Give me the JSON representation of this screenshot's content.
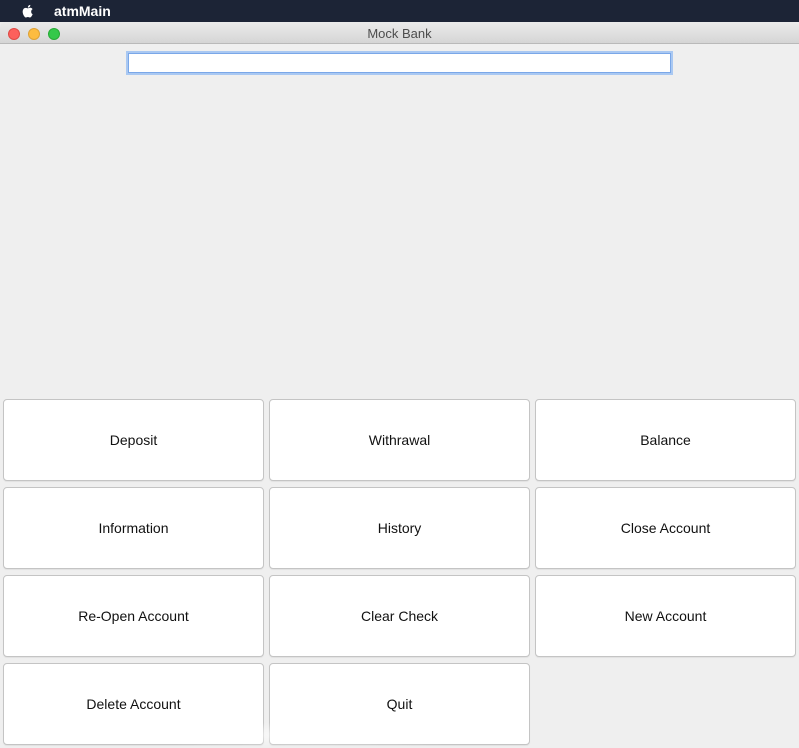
{
  "menubar": {
    "app_name": "atmMain"
  },
  "window": {
    "title": "Mock Bank"
  },
  "input": {
    "value": ""
  },
  "buttons": {
    "deposit": "Deposit",
    "withdrawal": "Withrawal",
    "balance": "Balance",
    "information": "Information",
    "history": "History",
    "close_account": "Close Account",
    "reopen_account": "Re-Open Account",
    "clear_check": "Clear Check",
    "new_account": "New Account",
    "delete_account": "Delete Account",
    "quit": "Quit"
  },
  "icons": {
    "apple": "apple-logo-icon",
    "close": "close-window-icon",
    "minimize": "minimize-window-icon",
    "zoom": "zoom-window-icon"
  },
  "colors": {
    "menubar_bg": "#1c2436",
    "close_light": "#fc605c",
    "minimize_light": "#fdbc40",
    "zoom_light": "#34c84a",
    "focus_ring": "#7aa7e8"
  }
}
